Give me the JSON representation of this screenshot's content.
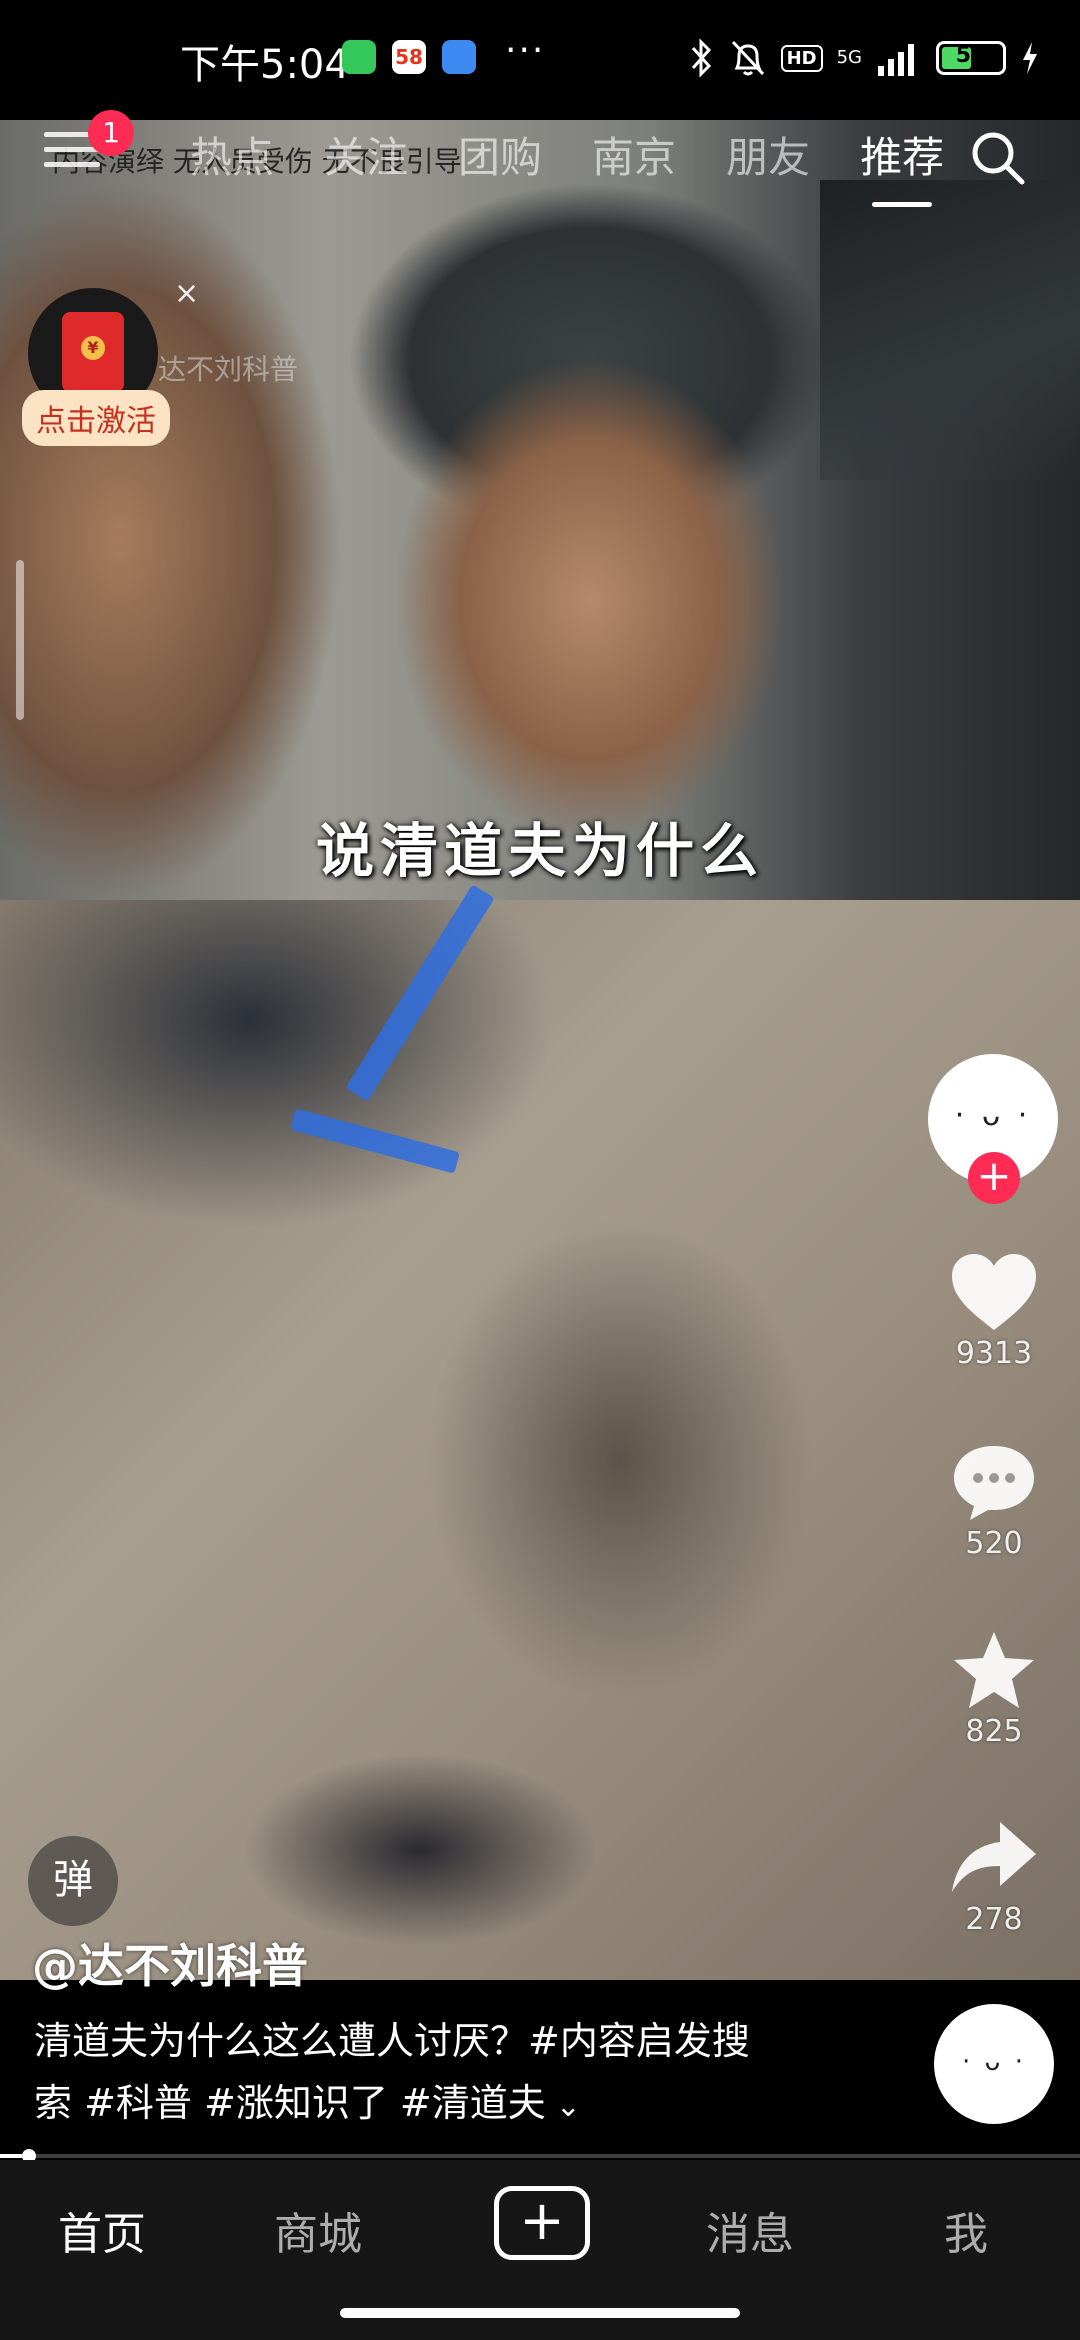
{
  "status_bar": {
    "time": "下午5:04",
    "app_badge_58": "58",
    "more": "···",
    "hd": "HD",
    "network": "5G",
    "battery": "54",
    "battery_level": 0.54
  },
  "video": {
    "watermark_text": "内容演绎 无人员受伤 无不良引导",
    "subtitle": "说清道夫为什么",
    "author_watermark": "达不刘科普"
  },
  "top_nav": {
    "badge_count": "1",
    "tabs": [
      {
        "label": "热点"
      },
      {
        "label": "关注"
      },
      {
        "label": "团购"
      },
      {
        "label": "南京"
      },
      {
        "label": "朋友"
      },
      {
        "label": "推荐",
        "active": true
      }
    ]
  },
  "float_widget": {
    "close": "×",
    "label": "点击激活",
    "coin": "¥"
  },
  "right_rail": {
    "avatar_face": "· ᴗ ·",
    "follow": "+",
    "like_count": "9313",
    "comment_count": "520",
    "favorite_count": "825",
    "share_count": "278"
  },
  "danmu": "弹",
  "post": {
    "author": "@达不刘科普",
    "caption_line1": "清道夫为什么这么遭人讨厌？#内容启发搜",
    "caption_line2": "索 #科普 #涨知识了 #清道夫",
    "expand": "⌄",
    "music_face": "· ᴗ ·",
    "progress": 0.02
  },
  "bottom_nav": {
    "home": "首页",
    "mall": "商城",
    "create": "+",
    "messages": "消息",
    "me": "我"
  },
  "colors": {
    "accent": "#fe2c55",
    "battery": "#4cd964"
  }
}
